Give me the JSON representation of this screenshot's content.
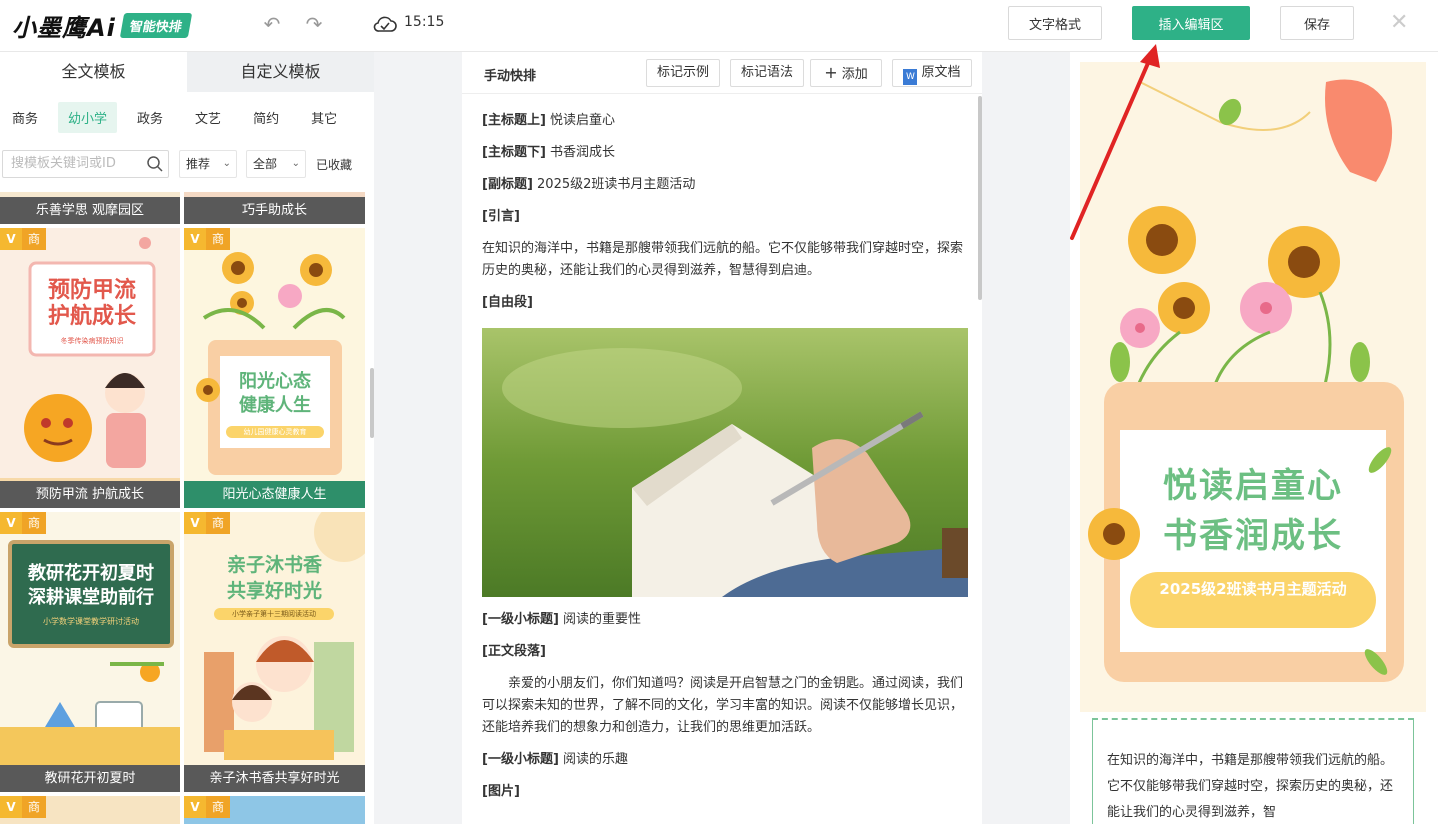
{
  "header": {
    "logo_text": "小墨鹰Ai",
    "logo_badge": "智能快排",
    "time": "15:15",
    "format_button": "文字格式",
    "insert_button": "插入编辑区",
    "save_button": "保存",
    "close": "✕"
  },
  "left_panel": {
    "tabs": [
      "全文模板",
      "自定义模板"
    ],
    "categories": [
      "商务",
      "幼小学",
      "政务",
      "文艺",
      "简约",
      "其它"
    ],
    "active_category": "幼小学",
    "search_placeholder": "搜模板关键词或ID",
    "sort_select": "推荐",
    "scope_select": "全部",
    "favorites": "已收藏",
    "cards": [
      {
        "label": "乐善学思 观摩园区"
      },
      {
        "label": "巧手助成长"
      },
      {
        "label": "预防甲流 护航成长",
        "badge_v": "V",
        "badge": "商",
        "title_lines": [
          "预防甲流",
          "护航成长"
        ],
        "subtitle": "冬季传染病预防知识"
      },
      {
        "label": "阳光心态健康人生",
        "badge_v": "V",
        "badge": "商",
        "title_lines": [
          "阳光心态",
          "健康人生"
        ],
        "subtitle": "幼儿园健康心灵教育"
      },
      {
        "label": "教研花开初夏时",
        "badge_v": "V",
        "badge": "商",
        "title_lines": [
          "教研花开初夏时",
          "深耕课堂助前行"
        ],
        "subtitle": "小学数学课堂教学研讨活动"
      },
      {
        "label": "亲子沐书香共享好时光",
        "badge_v": "V",
        "badge": "商",
        "title_lines": [
          "亲子沐书香",
          "共享好时光"
        ],
        "subtitle": "小学亲子第十三期阅读活动"
      },
      {
        "badge_v": "V",
        "badge": "商"
      },
      {
        "badge_v": "V",
        "badge": "商"
      }
    ]
  },
  "editor": {
    "title": "手动快排",
    "buttons": [
      "标记示例",
      "标记语法",
      "添加",
      "原文档"
    ],
    "add_icon": "+",
    "doc_icon": "W",
    "blocks": {
      "main_title_up_tag": "[主标题上]",
      "main_title_up": "悦读启童心",
      "main_title_down_tag": "[主标题下]",
      "main_title_down": "书香润成长",
      "subtitle_tag": "[副标题]",
      "subtitle": "2025级2班读书月主题活动",
      "intro_tag": "[引言]",
      "intro_text": "在知识的海洋中，书籍是那艘带领我们远航的船。它不仅能够带我们穿越时空，探索历史的奥秘，还能让我们的心灵得到滋养，智慧得到启迪。",
      "free_tag": "[自由段]",
      "h1_tag": "[一级小标题]",
      "h1_text": "阅读的重要性",
      "body_tag": "[正文段落]",
      "body_text": "亲爱的小朋友们，你们知道吗？阅读是开启智慧之门的金钥匙。通过阅读，我们可以探索未知的世界，了解不同的文化，学习丰富的知识。阅读不仅能够增长见识，还能培养我们的想象力和创造力，让我们的思维更加活跃。",
      "h1b_tag": "[一级小标题]",
      "h1b_text": "阅读的乐趣",
      "img_tag": "[图片]"
    }
  },
  "preview": {
    "title_line1": "悦读启童心",
    "title_line2": "书香润成长",
    "pill_text": "2025级2班读书月主题活动",
    "intro_text": "在知识的海洋中，书籍是那艘带领我们远航的船。它不仅能够带我们穿越时空，探索历史的奥秘，还能让我们的心灵得到滋养，智"
  },
  "colors": {
    "accent": "#2eb187",
    "title_green": "#6cbf82",
    "pill_yellow": "#fbd46a",
    "arrow_red": "#e02424"
  }
}
